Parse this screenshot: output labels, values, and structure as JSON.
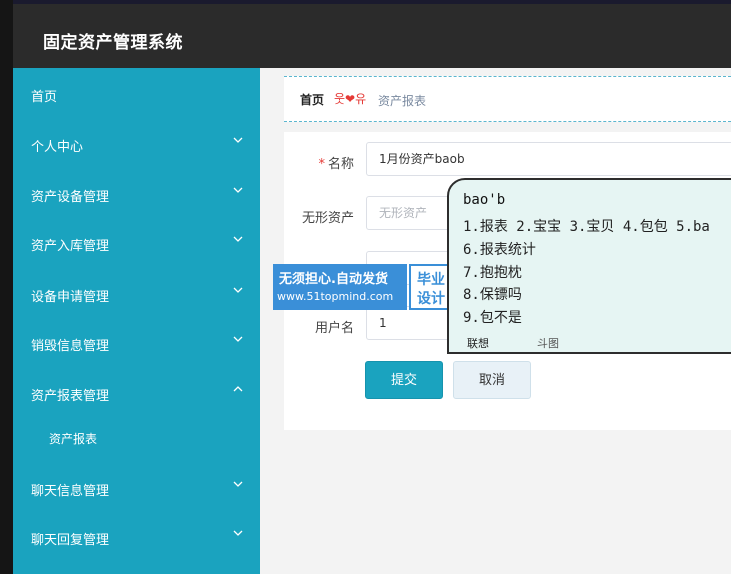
{
  "app": {
    "title": "固定资产管理系统"
  },
  "sidebar": {
    "items": [
      {
        "label": "首页",
        "chevron": "none"
      },
      {
        "label": "个人中心",
        "chevron": "down"
      },
      {
        "label": "资产设备管理",
        "chevron": "down"
      },
      {
        "label": "资产入库管理",
        "chevron": "down"
      },
      {
        "label": "设备申请管理",
        "chevron": "down"
      },
      {
        "label": "销毁信息管理",
        "chevron": "down"
      },
      {
        "label": "资产报表管理",
        "chevron": "up"
      },
      {
        "label": "资产报表",
        "chevron": "none"
      },
      {
        "label": "聊天信息管理",
        "chevron": "down"
      },
      {
        "label": "聊天回复管理",
        "chevron": "down"
      }
    ]
  },
  "breadcrumb": {
    "home": "首页",
    "separator": "웃❤유",
    "current": "资产报表"
  },
  "form": {
    "name": {
      "label": "名称",
      "required": "*",
      "value": "1月份资产baob"
    },
    "intangible": {
      "label": "无形资产",
      "placeholder": "无形资产"
    },
    "username": {
      "label": "用户名",
      "value": "1"
    },
    "submit_label": "提交",
    "cancel_label": "取消"
  },
  "ime": {
    "input": "bao'b",
    "row1": "1.报表 2.宝宝 3.宝贝 4.包包 5.ba",
    "row2": "6.报表统计",
    "row3": "7.抱抱枕",
    "row4": "8.保镖吗",
    "row5": "9.包不是",
    "tab_active": "联想",
    "tab_other": "斗图"
  },
  "watermark": {
    "line1": "无须担心.自动发货",
    "line2": "www.51topmind.com",
    "right1": "毕业",
    "right2": "设计"
  },
  "colors": {
    "accent": "#1aa3bf",
    "topbar": "#2b2b2b",
    "required": "#e53935",
    "watermark": "#3a8fd8"
  }
}
